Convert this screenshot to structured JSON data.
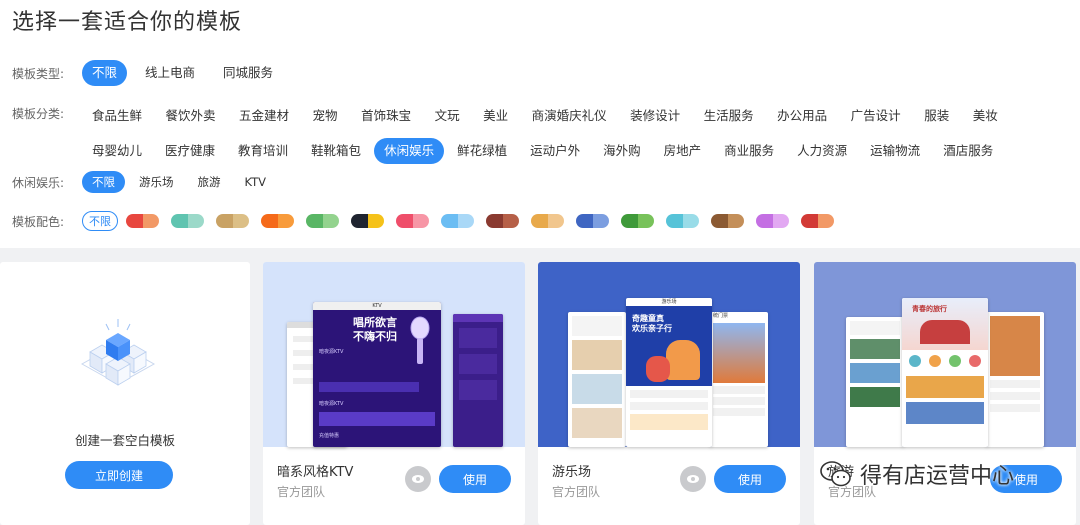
{
  "page_title": "选择一套适合你的模板",
  "filters": {
    "type": {
      "label": "模板类型:",
      "options": [
        "不限",
        "线上电商",
        "同城服务"
      ],
      "selected": "不限"
    },
    "category": {
      "label": "模板分类:",
      "line1": [
        "食品生鲜",
        "餐饮外卖",
        "五金建材",
        "宠物",
        "首饰珠宝",
        "文玩",
        "美业",
        "商演婚庆礼仪",
        "装修设计",
        "生活服务",
        "办公用品",
        "广告设计",
        "服装",
        "美妆"
      ],
      "line2": [
        "母婴幼儿",
        "医疗健康",
        "教育培训",
        "鞋靴箱包",
        "休闲娱乐",
        "鲜花绿植",
        "运动户外",
        "海外购",
        "房地产",
        "商业服务",
        "人力资源",
        "运输物流",
        "酒店服务"
      ],
      "selected": "休闲娱乐"
    },
    "leisure": {
      "label": "休闲娱乐:",
      "options": [
        "不限",
        "游乐场",
        "旅游",
        "KTV"
      ],
      "selected": "不限"
    },
    "color": {
      "label": "模板配色:",
      "any_label": "不限",
      "swatches": [
        [
          "#e8473f",
          "#f29966"
        ],
        [
          "#5fc4b0",
          "#9bd9c9"
        ],
        [
          "#c9a264",
          "#dcbf86"
        ],
        [
          "#f56a1a",
          "#f89b3b"
        ],
        [
          "#59b665",
          "#93d38e"
        ],
        [
          "#1f2430",
          "#f5c219"
        ],
        [
          "#ef4e6a",
          "#f796a6"
        ],
        [
          "#6bbdf3",
          "#a9d8f7"
        ],
        [
          "#8a3a30",
          "#b66048"
        ],
        [
          "#e8a94b",
          "#f1c68d"
        ],
        [
          "#3f66c2",
          "#7c9ee0"
        ],
        [
          "#3f9a3a",
          "#78c25a"
        ],
        [
          "#56c3d8",
          "#99dce8"
        ],
        [
          "#8b5a33",
          "#c48f59"
        ],
        [
          "#c46fe3",
          "#e2a8f2"
        ],
        [
          "#d23a36",
          "#f29966"
        ]
      ]
    }
  },
  "blank_card": {
    "title": "创建一套空白模板",
    "button": "立即创建"
  },
  "templates": [
    {
      "name": "暗系风格KTV",
      "team": "官方团队",
      "use": "使用",
      "thumb_bg": "#d5e3fb",
      "screen_text": {
        "status": "KTV",
        "headline1": "唱所欲言",
        "headline2": "不嗨不归",
        "store1": "暗夜源KTV",
        "store2": "暗夜源KTV",
        "section": "充值特惠"
      }
    },
    {
      "name": "游乐场",
      "team": "官方团队",
      "use": "使用",
      "thumb_bg": "#3e63c7",
      "screen_text": {
        "status": "游乐场",
        "banner1": "奇趣童真",
        "banner2": "欢乐亲子行",
        "tab": "统门票"
      }
    },
    {
      "name": "旅游",
      "team": "官方团队",
      "use": "使用",
      "thumb_bg": "#7f96d8",
      "screen_text": {
        "banner": "青春的旅行"
      }
    }
  ],
  "watermark": "得有店运营中心",
  "colors": {
    "primary": "#2f8cf6",
    "gallery_bg": "#f0f1f3"
  }
}
